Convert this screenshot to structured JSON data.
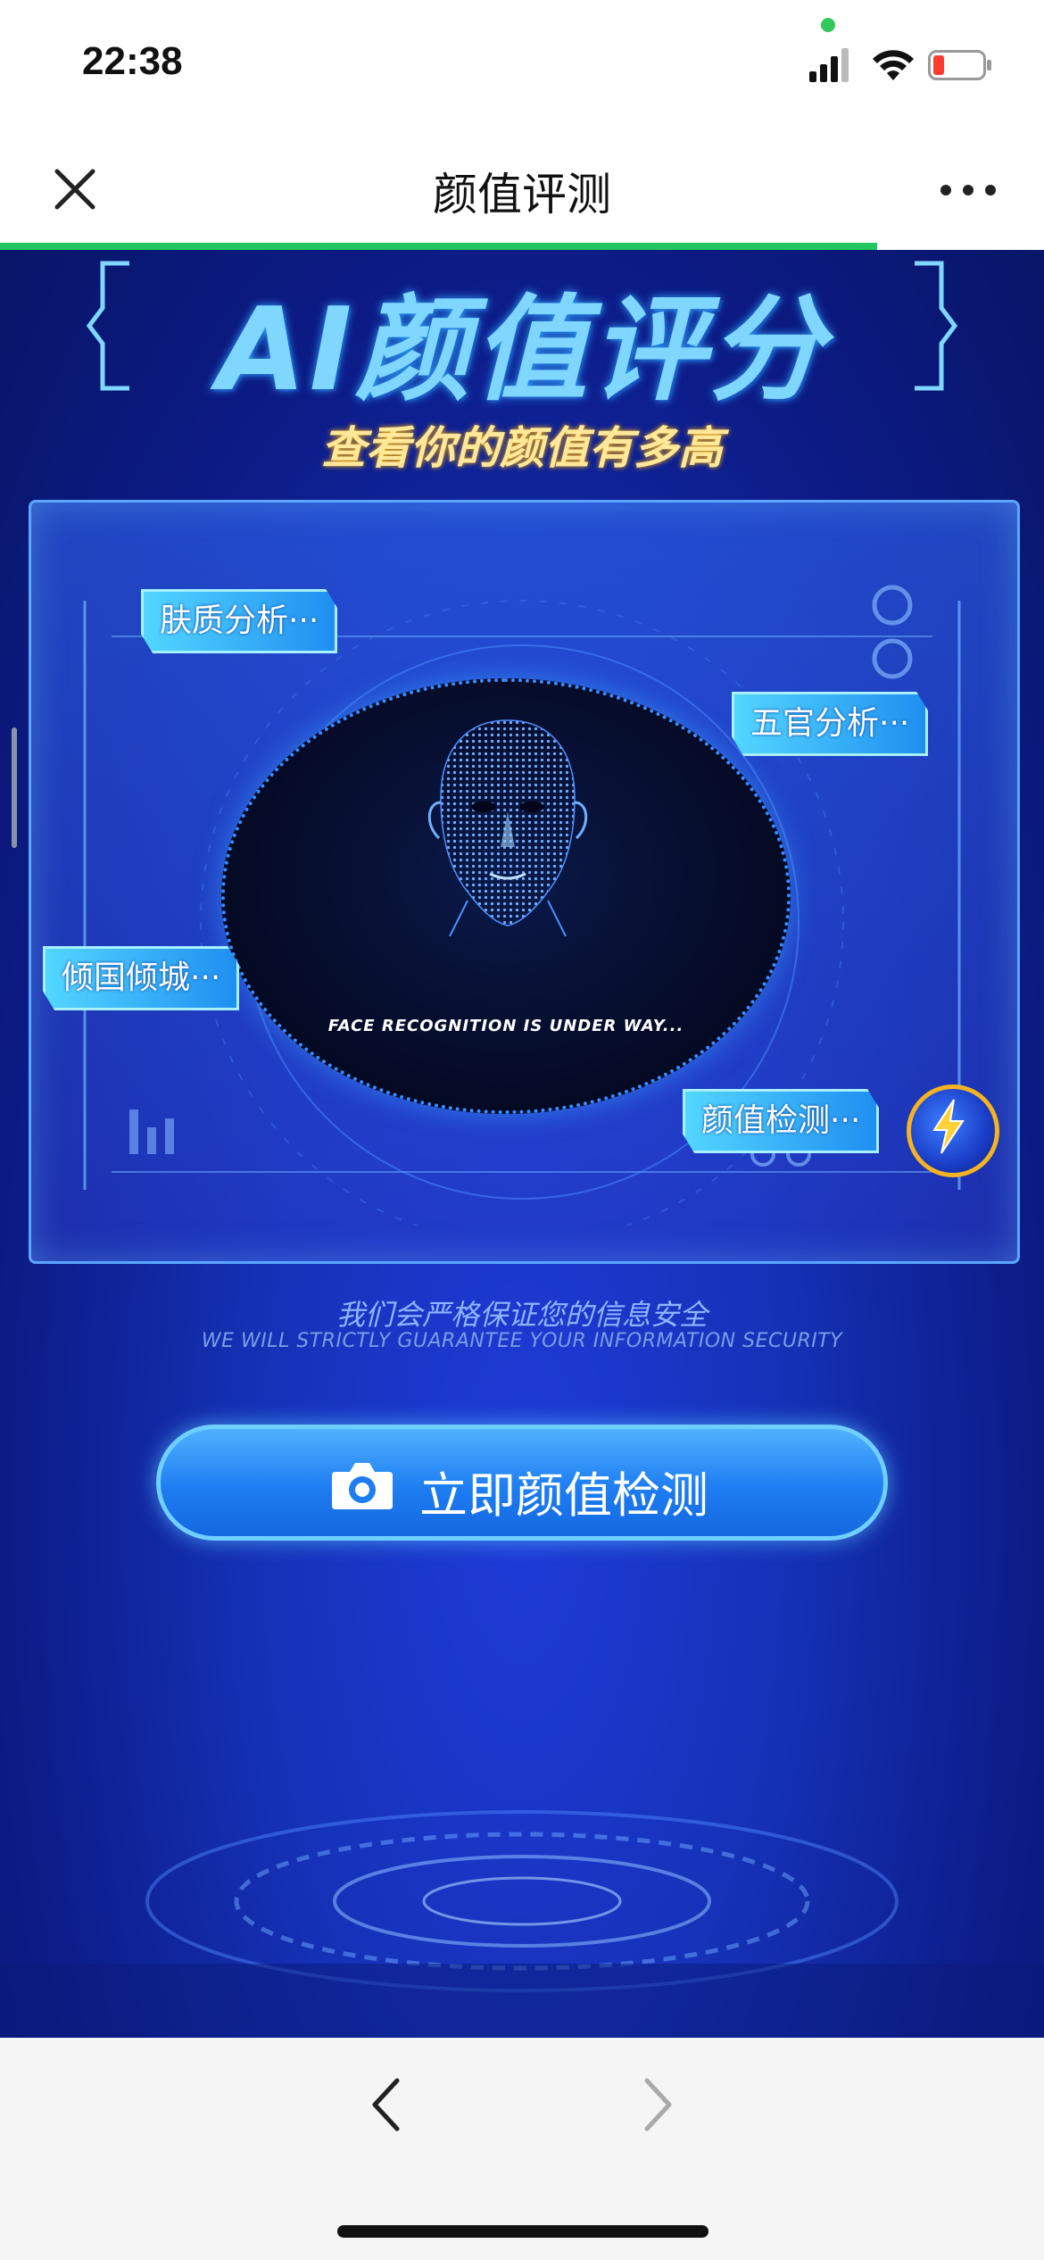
{
  "status_bar": {
    "time": "22:38"
  },
  "nav": {
    "title": "颜值评测",
    "progress_fraction": 0.84
  },
  "hero": {
    "title": "AI颜值评分",
    "subtitle": "查看你的颜值有多高"
  },
  "scan": {
    "caption": "FACE RECOGNITION IS UNDER WAY...",
    "tags": {
      "skin": "肤质分析···",
      "features": "五官分析···",
      "beauty": "倾国倾城···",
      "detect": "颜值检测···"
    }
  },
  "security": {
    "cn": "我们会严格保证您的信息安全",
    "en": "WE WILL STRICTLY GUARANTEE YOUR INFORMATION SECURITY"
  },
  "cta": {
    "label": "立即颜值检测",
    "icon": "camera-icon"
  },
  "toolbar": {
    "back_icon": "chevron-left-icon",
    "forward_icon": "chevron-right-icon"
  },
  "colors": {
    "progress": "#22c55e",
    "background": "#1532b8",
    "tag": "#53d6ff",
    "cta": "#1e7df2"
  }
}
